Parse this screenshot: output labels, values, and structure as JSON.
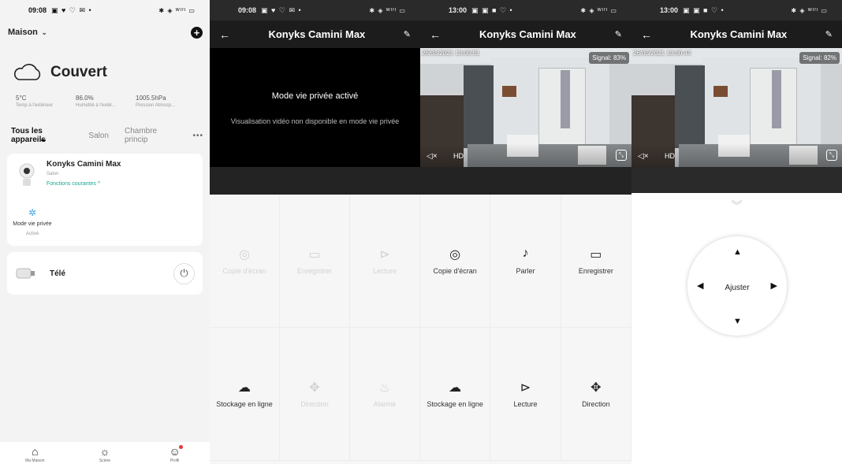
{
  "status1": {
    "time": "09:08",
    "left_icons": "▣ ♥ ♡ ✉ •",
    "right_icons": "✱ ◈ ᵂᴵᶠᴵ ▭"
  },
  "status2": {
    "time": "09:08",
    "left_icons": "▣ ♥ ♡ ✉ •",
    "right_icons": "✱ ◈ ᵂᴵᶠᴵ ▭"
  },
  "status3": {
    "time": "13:00",
    "left_icons": "▣ ▣ ■ ♡ •",
    "right_icons": "✱ ◈ ᵂᴵᶠᴵ ▭"
  },
  "status4": {
    "time": "13:00",
    "left_icons": "▣ ▣ ■ ♡ •",
    "right_icons": "✱ ◈ ᵂᴵᶠᴵ ▭"
  },
  "home": {
    "name": "Maison",
    "weather": "Couvert",
    "stats": [
      {
        "value": "5°C",
        "label": "Temp à l'extérieur"
      },
      {
        "value": "86.0%",
        "label": "Humidité à l'extér..."
      },
      {
        "value": "1005.5hPa",
        "label": "Pression Atmosp..."
      }
    ],
    "tabs": [
      "Tous les appareils",
      "Salon",
      "Chambre princip"
    ],
    "device": {
      "name": "Konyks Camini Max",
      "room": "Salon",
      "func": "Fonctions courantes ^",
      "privacy_label": "Mode vie privée",
      "privacy_state": "Activé"
    },
    "tele": {
      "name": "Télé"
    },
    "nav": [
      "Ma Maison",
      "Scène",
      "Profil"
    ]
  },
  "camera": {
    "title": "Konyks Camini Max"
  },
  "privacy": {
    "message": "Mode vie privée activé",
    "sub": "Visualisation vidéo non disponible en mode vie privée"
  },
  "live3": {
    "stamp": "26/03/2021 13:00:51",
    "signal": "Signal: 83%",
    "hd": "HD"
  },
  "live4": {
    "stamp": "26/03/2021 13:00:44",
    "signal": "Signal: 82%",
    "hd": "HD"
  },
  "grid2": [
    {
      "icon": "camera-icon",
      "label": "Copie d'écran"
    },
    {
      "icon": "video-icon",
      "label": "Enregistrer"
    },
    {
      "icon": "play-icon",
      "label": "Lecture"
    },
    {
      "icon": "cloud-icon",
      "label": "Stockage en ligne"
    },
    {
      "icon": "direction-icon",
      "label": "Direction"
    },
    {
      "icon": "alarm-icon",
      "label": "Alarme"
    }
  ],
  "grid3": [
    {
      "icon": "camera-icon",
      "label": "Copie d'écran"
    },
    {
      "icon": "mic-icon",
      "label": "Parler"
    },
    {
      "icon": "video-icon",
      "label": "Enregistrer"
    },
    {
      "icon": "cloud-icon",
      "label": "Stockage en ligne"
    },
    {
      "icon": "play-icon",
      "label": "Lecture"
    },
    {
      "icon": "direction-icon",
      "label": "Direction"
    }
  ],
  "ptz": {
    "center": "Ajuster"
  }
}
